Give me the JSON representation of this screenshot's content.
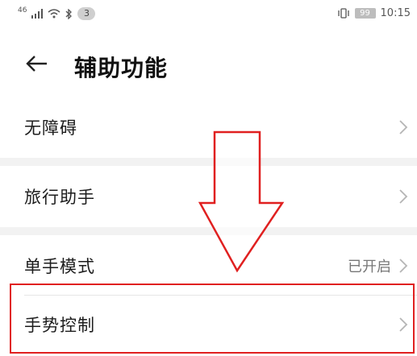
{
  "status_bar": {
    "network_label": "46",
    "notification_count": "3",
    "battery_level": "99",
    "time": "10:15",
    "icons": [
      "signal-icon",
      "wifi-icon",
      "bluetooth-icon",
      "vibrate-icon",
      "battery-icon"
    ]
  },
  "header": {
    "back_icon": "back-arrow-icon",
    "title": "辅助功能"
  },
  "settings": {
    "items": [
      {
        "label": "无障碍",
        "value": ""
      },
      {
        "label": "旅行助手",
        "value": ""
      },
      {
        "label": "单手模式",
        "value": "已开启"
      },
      {
        "label": "手势控制",
        "value": ""
      }
    ]
  },
  "annotation": {
    "arrow_icon": "down-arrow-outline-icon",
    "highlight_color": "#e02020"
  }
}
